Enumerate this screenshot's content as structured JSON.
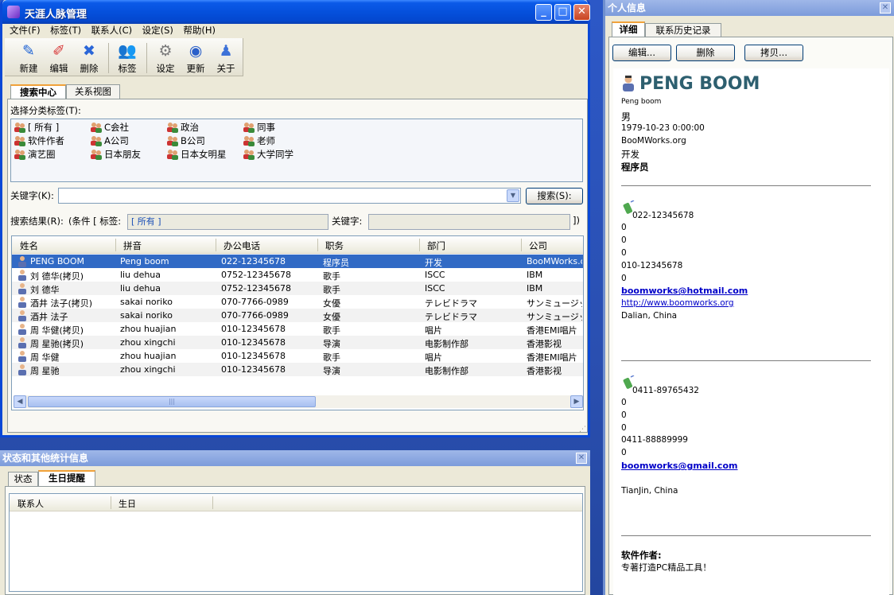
{
  "main_window": {
    "title": "天涯人脉管理",
    "menu": [
      "文件(F)",
      "标签(T)",
      "联系人(C)",
      "设定(S)",
      "帮助(H)"
    ],
    "toolbar": [
      {
        "label": "新建",
        "icon": "new-pen-icon"
      },
      {
        "label": "编辑",
        "icon": "edit-eraser-icon"
      },
      {
        "label": "删除",
        "icon": "delete-x-icon"
      },
      {
        "label": "标签",
        "icon": "tag-people-icon"
      },
      {
        "label": "设定",
        "icon": "settings-icon"
      },
      {
        "label": "更新",
        "icon": "update-icon"
      },
      {
        "label": "关于",
        "icon": "about-icon"
      }
    ],
    "tabs": [
      "搜索中心",
      "关系视图"
    ],
    "tag_section_label": "选择分类标签(T):",
    "tags": [
      "[ 所有 ]",
      "C会社",
      "政治",
      "同事",
      "软件作者",
      "A公司",
      "B公司",
      "老师",
      "演艺圈",
      "日本朋友",
      "日本女明星",
      "大学同学"
    ],
    "keyword_label": "关键字(K):",
    "keyword_value": "",
    "search_button": "搜索(S):",
    "results_label": "搜索结果(R):",
    "condition_prefix": "(条件 [ 标签:",
    "condition_tag": "[ 所有 ]",
    "condition_keyword_label": "关键字:",
    "condition_keyword": "",
    "condition_suffix": "])",
    "columns": [
      "姓名",
      "拼音",
      "办公电话",
      "职务",
      "部门",
      "公司"
    ],
    "rows": [
      [
        "PENG BOOM",
        "Peng boom",
        "022-12345678",
        "程序员",
        "开发",
        "BooMWorks.org"
      ],
      [
        "刘 德华(拷贝)",
        "liu dehua",
        "0752-12345678",
        "歌手",
        "ISCC",
        "IBM"
      ],
      [
        "刘 德华",
        "liu dehua",
        "0752-12345678",
        "歌手",
        "ISCC",
        "IBM"
      ],
      [
        "酒井 法子(拷贝)",
        "sakai noriko",
        "070-7766-0989",
        "女優",
        "テレビドラマ",
        "サンミュージック"
      ],
      [
        "酒井 法子",
        "sakai noriko",
        "070-7766-0989",
        "女優",
        "テレビドラマ",
        "サンミュージック"
      ],
      [
        "周 华健(拷贝)",
        "zhou huajian",
        "010-12345678",
        "歌手",
        "唱片",
        "香港EMI唱片"
      ],
      [
        "周 星驰(拷贝)",
        "zhou xingchi",
        "010-12345678",
        "导演",
        "电影制作部",
        "香港影视"
      ],
      [
        "周 华健",
        "zhou huajian",
        "010-12345678",
        "歌手",
        "唱片",
        "香港EMI唱片"
      ],
      [
        "周 星驰",
        "zhou xingchi",
        "010-12345678",
        "导演",
        "电影制作部",
        "香港影视"
      ]
    ],
    "scroll_thumb": "|||"
  },
  "status_window": {
    "title": "状态和其他统计信息",
    "tabs": [
      "状态",
      "生日提醒"
    ],
    "columns": [
      "联系人",
      "生日"
    ]
  },
  "info_window": {
    "title": "个人信息",
    "tabs": [
      "详细",
      "联系历史记录"
    ],
    "buttons": [
      "编辑...",
      "删除",
      "拷贝..."
    ],
    "name": "PENG BOOM",
    "pinyin": "Peng boom",
    "gender": "男",
    "birthday": "1979-10-23 0:00:00",
    "company": "BooMWorks.org",
    "department": "开发",
    "position": "程序员",
    "block1": {
      "phone": "022-12345678",
      "lines": [
        "0",
        "0",
        "0",
        "010-12345678",
        "0"
      ],
      "email": "boomworks@hotmail.com",
      "url": "http://www.boomworks.org",
      "address": "Dalian, China"
    },
    "block2": {
      "phone": "0411-89765432",
      "lines": [
        "0",
        "0",
        "0",
        "0411-88889999",
        "0"
      ],
      "email": "boomworks@gmail.com",
      "address": "TianJin, China"
    },
    "author_label": "软件作者:",
    "author_text": "专著打造PC精品工具！"
  },
  "colors": {
    "titlebar": "#0550dc",
    "selection": "#316ac5",
    "link": "#0000c8",
    "tab_accent": "#f1a23a"
  }
}
